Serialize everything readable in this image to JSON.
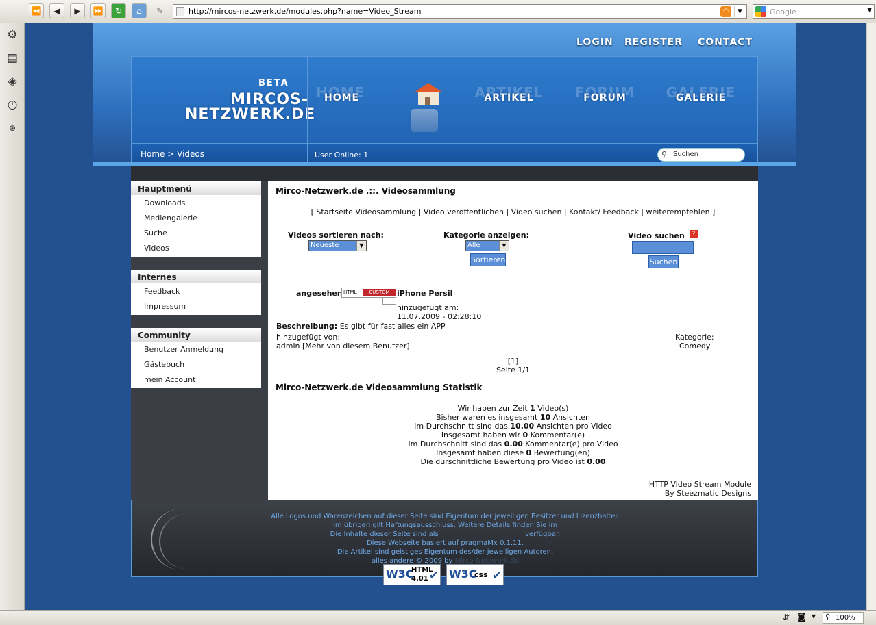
{
  "browser": {
    "url": "http://mircos-netzwerk.de/modules.php?name=Video_Stream",
    "search_placeholder": "Google",
    "zoom": "100%"
  },
  "site": {
    "top_links": [
      "LOGIN",
      "REGISTER",
      "CONTACT"
    ],
    "logo": {
      "beta": "BETA",
      "line1": "MIRCOS-",
      "line2": "NETZWERK.DE"
    },
    "nav": [
      {
        "ghost": "HOME",
        "label": "HOME"
      },
      {
        "ghost": "ARTIKEL",
        "label": "ARTIKEL"
      },
      {
        "ghost": "FORUM",
        "label": "FORUM"
      },
      {
        "ghost": "GALERIE",
        "label": "GALERIE"
      }
    ],
    "breadcrumb": "Home > Videos",
    "users_online": "User Online: 1",
    "search_placeholder": "Suchen"
  },
  "menus": [
    {
      "title": "Hauptmenü",
      "items": [
        "Downloads",
        "Mediengalerie",
        "Suche",
        "Videos"
      ]
    },
    {
      "title": "Internes",
      "items": [
        "Feedback",
        "Impressum"
      ]
    },
    {
      "title": "Community",
      "items": [
        "Benutzer Anmeldung",
        "Gästebuch",
        "mein Account"
      ]
    }
  ],
  "content": {
    "title": "Mirco-Netzwerk.de .::. Videosammlung",
    "links": "[ Startseite Videosammlung | Video veröffentlichen | Video suchen | Kontakt/ Feedback | weiterempfehlen ]",
    "sort_label": "Videos sortieren nach:",
    "sort_value": "Neueste",
    "category_label": "Kategorie anzeigen:",
    "category_value": "Alle",
    "sort_button": "Sortieren",
    "search_label": "Video suchen",
    "search_button": "Suchen",
    "video": {
      "prefix": "angesehen",
      "badge_left": "HTML",
      "badge_right": "CUSTOM",
      "title": "iPhone Persil",
      "added_label": "hinzugefügt am:",
      "added_date": "11.07.2009 - 02:28:10",
      "desc_label": "Beschreibung:",
      "desc_text": "Es gibt für fast alles ein APP",
      "by_label": "hinzugefügt von:",
      "by_value": "admin [Mehr von diesem Benutzer]",
      "cat_label": "Kategorie:",
      "cat_value": "Comedy"
    },
    "pagination": "[1]",
    "page_of": "Seite 1/1",
    "stats_title": "Mirco-Netzwerk.de Videosammlung Statistik",
    "stats": [
      {
        "pre": "Wir haben zur Zeit ",
        "val": "1",
        "post": " Video(s)"
      },
      {
        "pre": "Bisher waren es insgesamt ",
        "val": "10",
        "post": " Ansichten"
      },
      {
        "pre": "Im Durchschnitt sind das ",
        "val": "10.00",
        "post": " Ansichten pro Video"
      },
      {
        "pre": "Insgesamt haben wir ",
        "val": "0",
        "post": " Kommentar(e)"
      },
      {
        "pre": "Im Durchschnitt sind das ",
        "val": "0.00",
        "post": " Kommentar(e) pro Video"
      },
      {
        "pre": "Insgesamt haben diese ",
        "val": "0",
        "post": " Bewertung(en)"
      },
      {
        "pre": "Die durschnittliche Bewertung pro Video ist ",
        "val": "0.00",
        "post": ""
      }
    ],
    "module_credit1": "HTTP Video Stream Module",
    "module_credit2": "By Steezmatic Designs"
  },
  "footer": {
    "lines": [
      "Alle Logos und Warenzeichen auf dieser Seite sind Eigentum der jeweiligen Besitzer und Lizenzhalter.",
      "Im übrigen gilt Haftungsausschluss. Weitere Details finden Sie im",
      "Die Inhalte dieser Seite sind als",
      "Diese Webseite basiert auf pragmaMx 0.1.11.",
      "Die Artikel sind geistiges Eigentum des/der jeweiligen Autoren,",
      "alles andere © 2009 by"
    ],
    "line3_suffix": "verfügbar.",
    "line6_link": "Mirco-Netzwerk.de",
    "w3c_html": "HTML",
    "w3c_html_ver": "4.01",
    "w3c_css": "css"
  },
  "colors": {
    "page_bg": "#23508f",
    "header": "#2f7ccf",
    "accent_button": "#5b8fd8",
    "footer_link": "#6fa9e6"
  }
}
